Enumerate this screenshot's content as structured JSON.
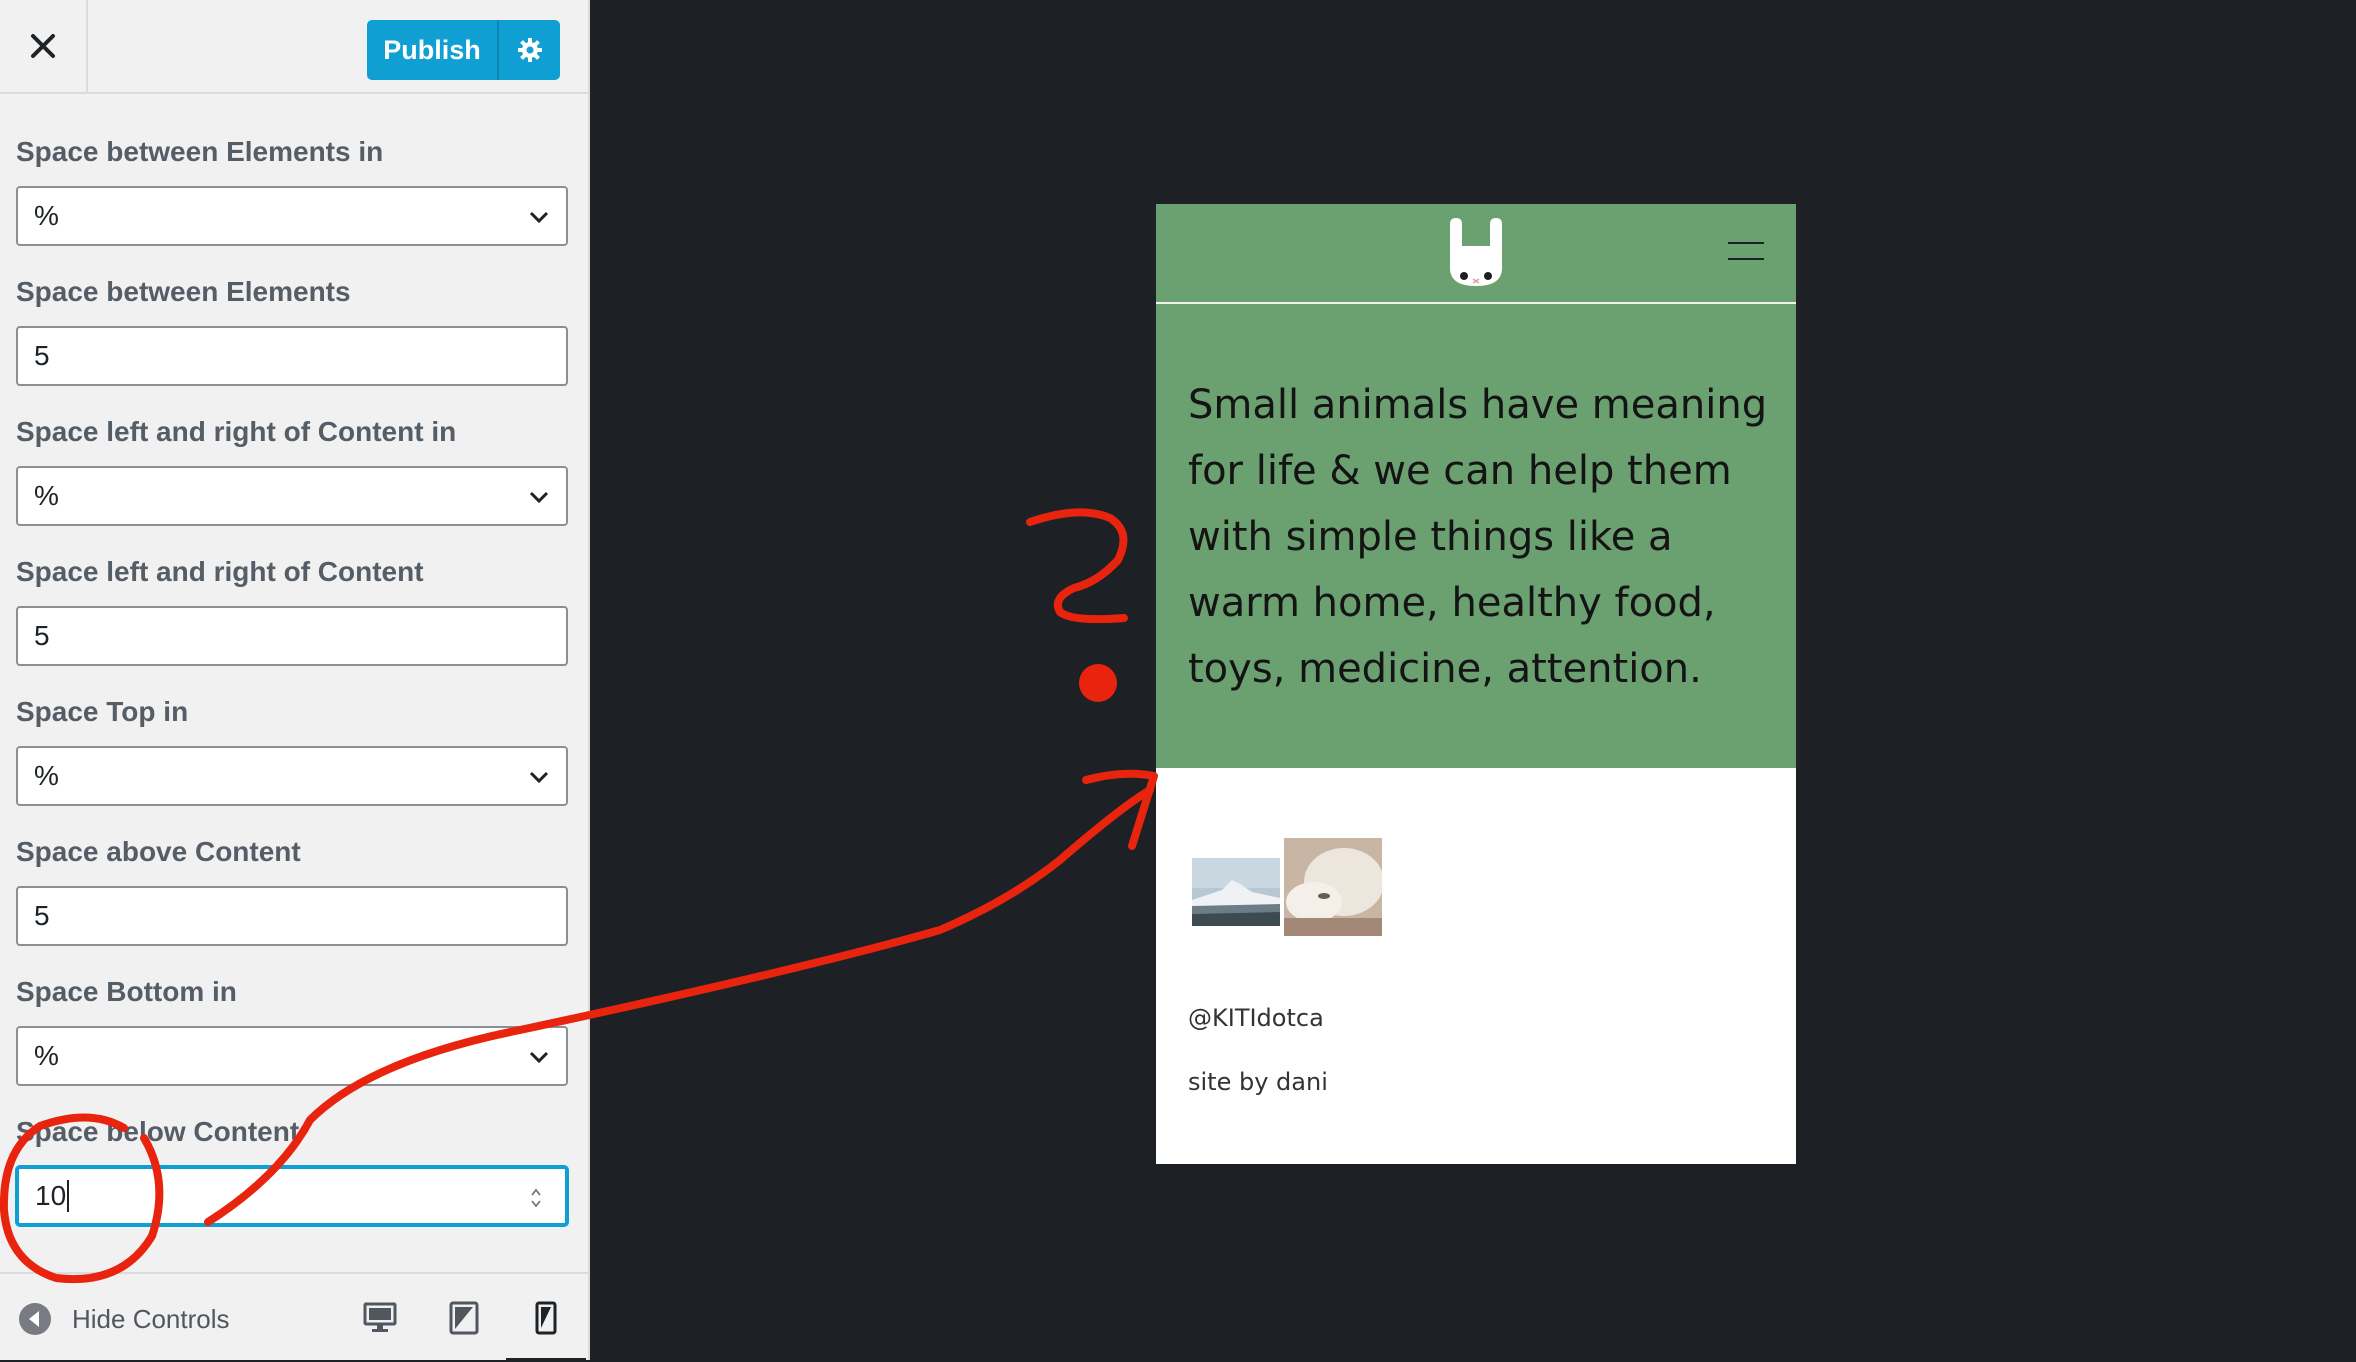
{
  "header": {
    "publish_label": "Publish"
  },
  "controls": [
    {
      "label": "Space between Elements in",
      "type": "select",
      "value": "%"
    },
    {
      "label": "Space between Elements",
      "type": "number",
      "value": "5"
    },
    {
      "label": "Space left and right of Content in",
      "type": "select",
      "value": "%"
    },
    {
      "label": "Space left and right of Content",
      "type": "number",
      "value": "5"
    },
    {
      "label": "Space Top in",
      "type": "select",
      "value": "%"
    },
    {
      "label": "Space above Content",
      "type": "number",
      "value": "5"
    },
    {
      "label": "Space Bottom in",
      "type": "select",
      "value": "%"
    },
    {
      "label": "Space below Content",
      "type": "number",
      "value": "10"
    }
  ],
  "footer": {
    "hide_controls_label": "Hide Controls"
  },
  "preview": {
    "hero_text": "Small animals have meaning for life & we can help them with simple things like a warm home, healthy food, toys, medicine, attention.",
    "twitter_handle": "@KITIdotca",
    "credit": "site by dani"
  },
  "colors": {
    "accent": "#0f9fd3",
    "hero_green": "#6ba070",
    "annotation_red": "#e8240f",
    "canvas": "#1d2024"
  },
  "icons": {
    "close": "close-icon",
    "settings": "gear-icon",
    "hide_controls": "arrow-left-circle-icon",
    "desktop": "desktop-icon",
    "tablet": "tablet-icon",
    "mobile": "mobile-icon",
    "menu": "hamburger-menu-icon",
    "logo": "bunny-logo"
  }
}
